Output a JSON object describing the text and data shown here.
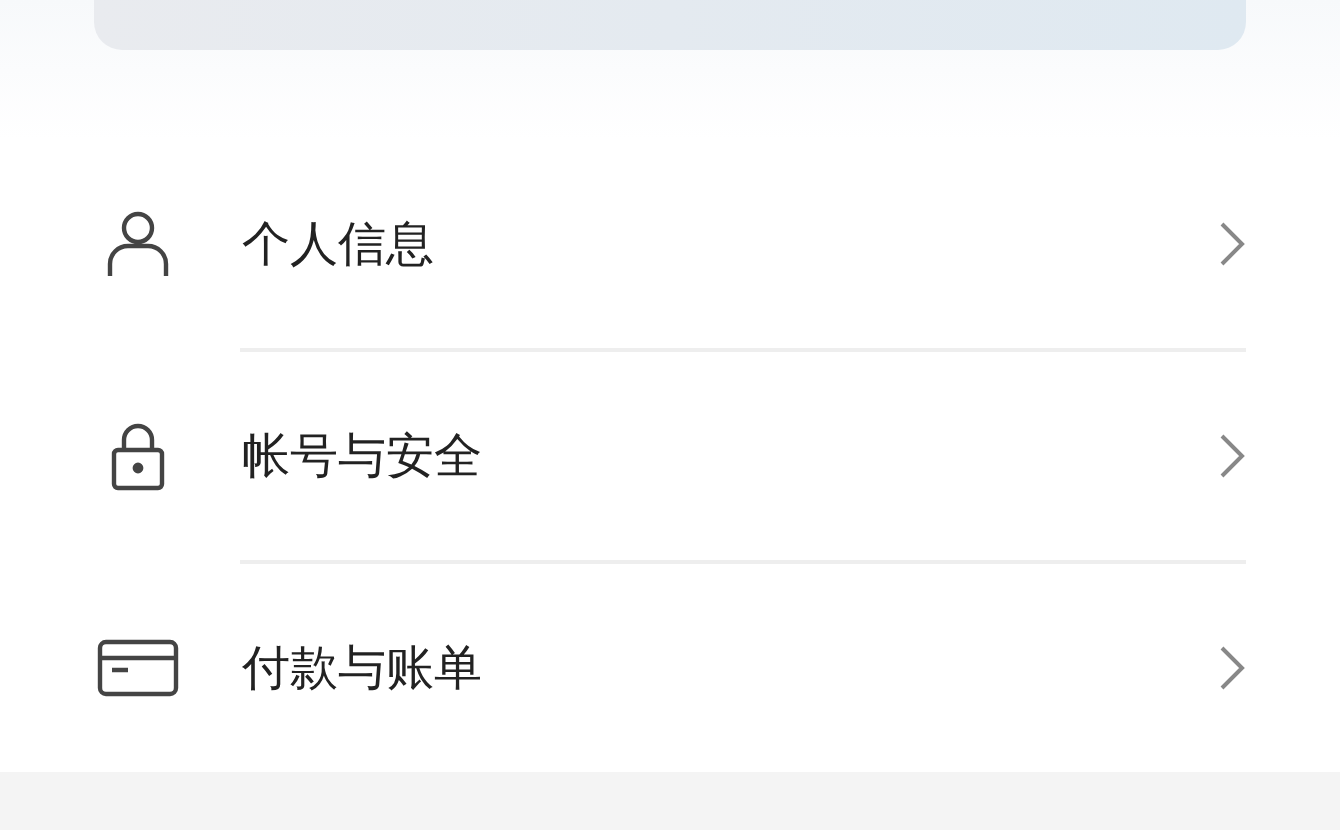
{
  "menu": [
    {
      "kind": "person",
      "label": "个人信息"
    },
    {
      "kind": "lock",
      "label": "帐号与安全"
    },
    {
      "kind": "card",
      "label": "付款与账单"
    }
  ]
}
